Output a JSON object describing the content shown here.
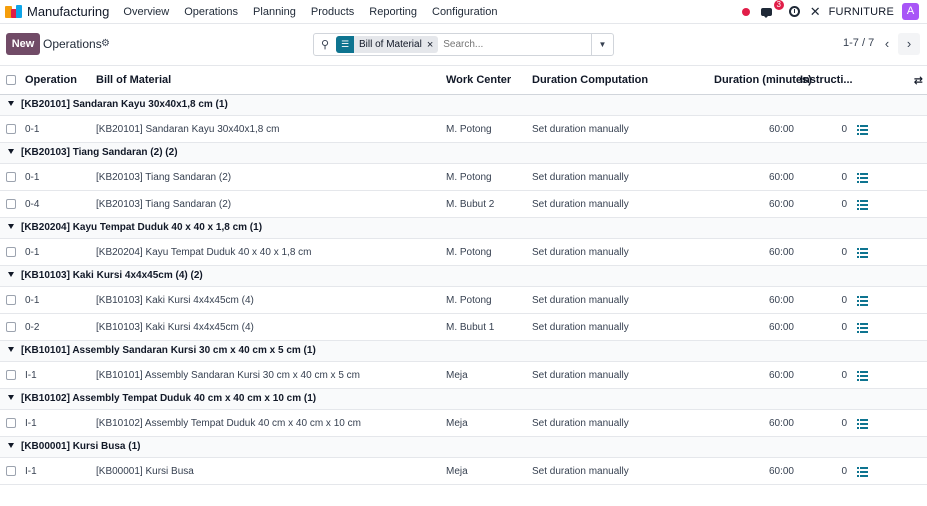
{
  "navbar": {
    "app_name": "Manufacturing",
    "menu": [
      "Overview",
      "Operations",
      "Planning",
      "Products",
      "Reporting",
      "Configuration"
    ],
    "chat_count": "3",
    "company": "FURNITURE",
    "avatar_letter": "A"
  },
  "control": {
    "new_label": "New",
    "breadcrumb": "Operations",
    "facet_label": "Bill of Material",
    "search_placeholder": "Search...",
    "pager": "1-7 / 7"
  },
  "table": {
    "headers": {
      "operation": "Operation",
      "bom": "Bill of Material",
      "work_center": "Work Center",
      "duration_computation": "Duration Computation",
      "duration": "Duration (minutes)",
      "instructions": "Instructi..."
    },
    "groups": [
      {
        "label": "[KB20101] Sandaran Kayu 30x40x1,8 cm (1)",
        "rows": [
          {
            "op": "0-1",
            "bom": "[KB20101] Sandaran Kayu 30x40x1,8 cm",
            "wc": "M. Potong",
            "dc": "Set duration manually",
            "dur": "60:00",
            "ins": "0"
          }
        ]
      },
      {
        "label": "[KB20103] Tiang Sandaran (2) (2)",
        "rows": [
          {
            "op": "0-1",
            "bom": "[KB20103] Tiang Sandaran (2)",
            "wc": "M. Potong",
            "dc": "Set duration manually",
            "dur": "60:00",
            "ins": "0"
          },
          {
            "op": "0-4",
            "bom": "[KB20103] Tiang Sandaran (2)",
            "wc": "M. Bubut 2",
            "dc": "Set duration manually",
            "dur": "60:00",
            "ins": "0"
          }
        ]
      },
      {
        "label": "[KB20204] Kayu Tempat Duduk 40 x 40 x 1,8 cm (1)",
        "rows": [
          {
            "op": "0-1",
            "bom": "[KB20204] Kayu Tempat Duduk 40 x 40 x 1,8 cm",
            "wc": "M. Potong",
            "dc": "Set duration manually",
            "dur": "60:00",
            "ins": "0"
          }
        ]
      },
      {
        "label": "[KB10103] Kaki Kursi 4x4x45cm (4) (2)",
        "rows": [
          {
            "op": "0-1",
            "bom": "[KB10103] Kaki Kursi 4x4x45cm (4)",
            "wc": "M. Potong",
            "dc": "Set duration manually",
            "dur": "60:00",
            "ins": "0"
          },
          {
            "op": "0-2",
            "bom": "[KB10103] Kaki Kursi 4x4x45cm (4)",
            "wc": "M. Bubut 1",
            "dc": "Set duration manually",
            "dur": "60:00",
            "ins": "0"
          }
        ]
      },
      {
        "label": "[KB10101] Assembly Sandaran Kursi 30 cm x 40 cm x 5 cm (1)",
        "rows": [
          {
            "op": "I-1",
            "bom": "[KB10101] Assembly Sandaran Kursi 30 cm x 40 cm x 5 cm",
            "wc": "Meja",
            "dc": "Set duration manually",
            "dur": "60:00",
            "ins": "0"
          }
        ]
      },
      {
        "label": "[KB10102] Assembly Tempat Duduk 40 cm x 40 cm x 10 cm (1)",
        "rows": [
          {
            "op": "I-1",
            "bom": "[KB10102] Assembly Tempat Duduk 40 cm x 40 cm x 10 cm",
            "wc": "Meja",
            "dc": "Set duration manually",
            "dur": "60:00",
            "ins": "0"
          }
        ]
      },
      {
        "label": "[KB00001] Kursi Busa (1)",
        "rows": [
          {
            "op": "I-1",
            "bom": "[KB00001] Kursi Busa",
            "wc": "Meja",
            "dc": "Set duration manually",
            "dur": "60:00",
            "ins": "0"
          }
        ]
      }
    ]
  }
}
